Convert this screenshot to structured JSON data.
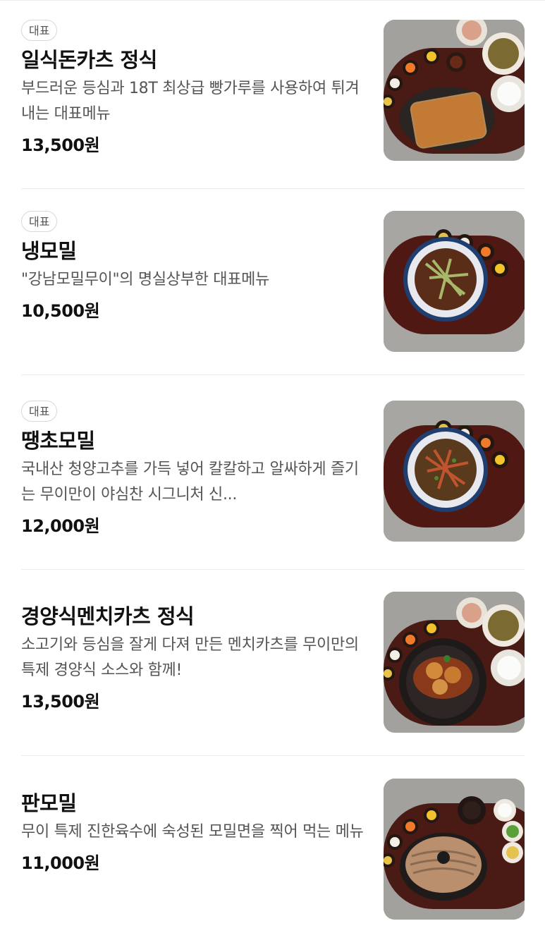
{
  "menu": {
    "items": [
      {
        "badge": "대표",
        "name": "일식돈카츠 정식",
        "desc": "부드러운 등심과 18T 최상급 빵가루를 사용하여 튀겨내는 대표메뉴",
        "price": "13,500원",
        "image": "tonkatsu-set-photo"
      },
      {
        "badge": "대표",
        "name": "냉모밀",
        "desc": "\"강남모밀무이\"의 명실상부한 대표메뉴",
        "price": "10,500원",
        "image": "cold-soba-photo"
      },
      {
        "badge": "대표",
        "name": "땡초모밀",
        "desc": "국내산 청양고추를 가득 넣어 칼칼하고 알싸하게 즐기는 무이만이 야심찬 시그니처 신...",
        "price": "12,000원",
        "image": "spicy-soba-photo"
      },
      {
        "badge": "",
        "name": "경양식멘치카츠 정식",
        "desc": "소고기와 등심을 잘게 다져 만든 멘치카츠를 무이만의 특제 경양식 소스와 함께!",
        "price": "13,500원",
        "image": "menchi-katsu-set-photo"
      },
      {
        "badge": "",
        "name": "판모밀",
        "desc": "무이 특제 진한육수에 숙성된 모밀면을 찍어 먹는 메뉴",
        "price": "11,000원",
        "image": "tray-soba-photo"
      }
    ]
  }
}
